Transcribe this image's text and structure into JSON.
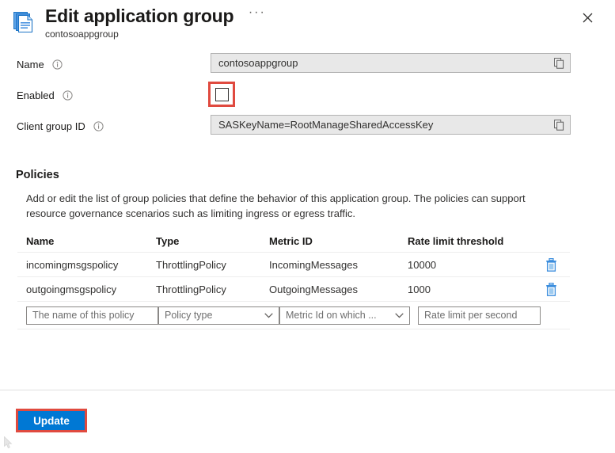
{
  "header": {
    "icon": "application-group-icon",
    "title": "Edit application group",
    "subtitle": "contosoappgroup",
    "ellipsis": "···",
    "close_icon": "close-icon"
  },
  "form": {
    "name": {
      "label": "Name",
      "info_icon": "info-icon",
      "value": "contosoappgroup",
      "copy_icon": "copy-icon"
    },
    "enabled": {
      "label": "Enabled",
      "info_icon": "info-icon",
      "checked": false,
      "highlight_color": "#e04a3f"
    },
    "client_group_id": {
      "label": "Client group ID",
      "info_icon": "info-icon",
      "value": "SASKeyName=RootManageSharedAccessKey",
      "copy_icon": "copy-icon"
    }
  },
  "policies": {
    "title": "Policies",
    "description": "Add or edit the list of group policies that define the behavior of this application group. The policies can support resource governance scenarios such as limiting ingress or egress traffic.",
    "columns": [
      "Name",
      "Type",
      "Metric ID",
      "Rate limit threshold"
    ],
    "rows": [
      {
        "name": "incomingmsgspolicy",
        "type": "ThrottlingPolicy",
        "metric_id": "IncomingMessages",
        "rate_limit_threshold": "10000",
        "delete_icon": "trash-icon"
      },
      {
        "name": "outgoingmsgspolicy",
        "type": "ThrottlingPolicy",
        "metric_id": "OutgoingMessages",
        "rate_limit_threshold": "1000",
        "delete_icon": "trash-icon"
      }
    ],
    "new_row": {
      "name_placeholder": "The name of this policy",
      "type_placeholder": "Policy type",
      "metric_placeholder": "Metric Id on which ...",
      "rate_placeholder": "Rate limit per second",
      "name_value": "",
      "rate_value": "",
      "chevron_icon": "chevron-down-icon"
    }
  },
  "footer": {
    "update_label": "Update",
    "update_color": "#0078d4",
    "highlight_color": "#e04a3f"
  }
}
